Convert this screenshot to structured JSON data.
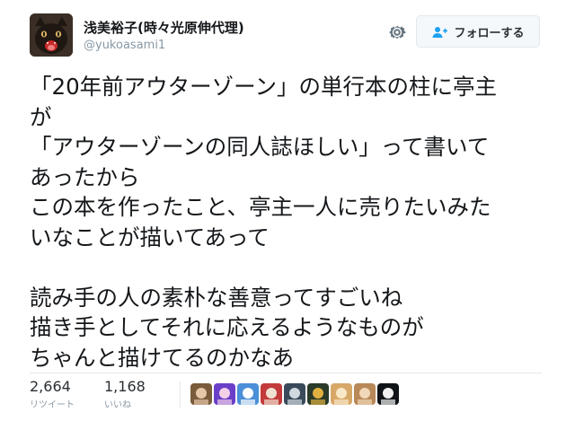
{
  "author": {
    "name": "浅美裕子(時々光原伸代理)",
    "handle": "@yukoasami1"
  },
  "actions": {
    "settings_icon": "gear-icon",
    "follow_label": "フォローする",
    "follow_icon": "add-person-icon"
  },
  "tweet": {
    "lines": [
      "「20年前アウターゾーン」の単行本の柱に亭主",
      "が",
      "「アウターゾーンの同人誌ほしい」って書いて",
      "あったから",
      "この本を作ったこと、亭主一人に売りたいみた",
      "いなことが描いてあって",
      "",
      "読み手の人の素朴な善意ってすごいね",
      "描き手としてそれに応えるようなものが",
      "ちゃんと描けてるのかなあ"
    ]
  },
  "stats": {
    "retweets": {
      "count": "2,664",
      "label": "リツイート"
    },
    "likes": {
      "count": "1,168",
      "label": "いいね"
    }
  },
  "likers": [
    {
      "colors": [
        "#7a5c3a",
        "#e6c8a8"
      ]
    },
    {
      "colors": [
        "#6a3fc8",
        "#f2d0e8"
      ]
    },
    {
      "colors": [
        "#4a8fd8",
        "#ffffff"
      ]
    },
    {
      "colors": [
        "#c23a3a",
        "#f0e0d0"
      ]
    },
    {
      "colors": [
        "#3a4a5a",
        "#d0d8e0"
      ]
    },
    {
      "colors": [
        "#2a3a2a",
        "#e0b040"
      ]
    },
    {
      "colors": [
        "#d8a868",
        "#f8e8c8"
      ]
    },
    {
      "colors": [
        "#b88858",
        "#f0d8b8"
      ]
    },
    {
      "colors": [
        "#101418",
        "#f0f0f0"
      ]
    }
  ]
}
